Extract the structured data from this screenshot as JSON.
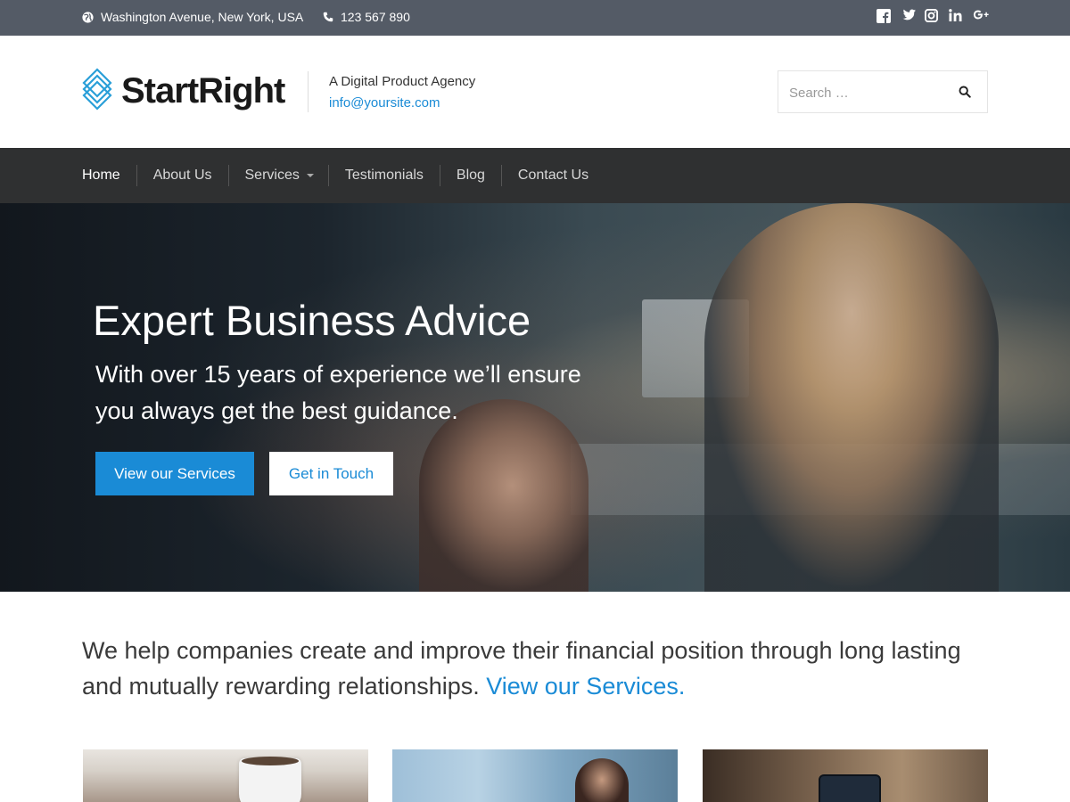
{
  "topbar": {
    "address": "Washington Avenue, New York, USA",
    "phone": "123 567 890",
    "social": [
      "facebook-icon",
      "twitter-icon",
      "instagram-icon",
      "linkedin-icon",
      "google-plus-icon"
    ],
    "bg_color": "#545b66"
  },
  "header": {
    "logo_text": "StartRight",
    "tagline": "A Digital Product Agency",
    "email": "info@yoursite.com",
    "search_placeholder": "Search …"
  },
  "nav": {
    "items": [
      {
        "label": "Home"
      },
      {
        "label": "About Us"
      },
      {
        "label": "Services"
      },
      {
        "label": "Testimonials"
      },
      {
        "label": "Blog"
      },
      {
        "label": "Contact Us"
      }
    ],
    "bg_color": "#2f3031"
  },
  "hero": {
    "title": "Expert Business Advice",
    "subtitle": "With over 15 years of experience we’ll ensure you always get the best guidance.",
    "primary_button": "View our Services",
    "secondary_button": "Get in Touch"
  },
  "intro": {
    "text": "We help companies create and improve their financial position through long lasting and mutually rewarding relationships. ",
    "link": "View our Services."
  },
  "colors": {
    "accent": "#1a8bd6"
  }
}
